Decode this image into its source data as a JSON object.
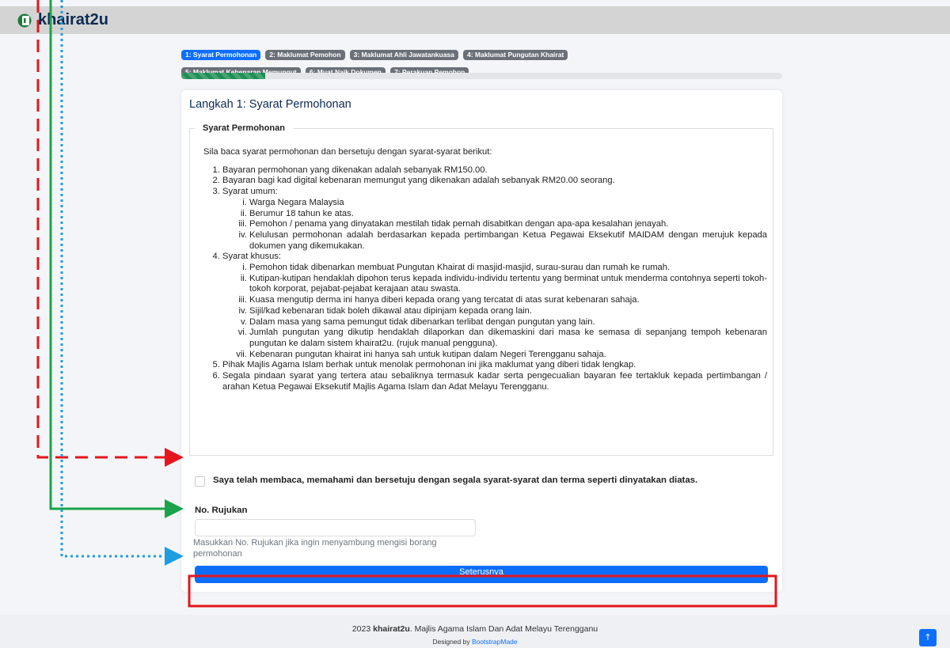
{
  "brand": {
    "name": "khairat2u",
    "logo_icon": "flag-logo-icon"
  },
  "steps": [
    {
      "label": "1: Syarat Permohonan",
      "active": true
    },
    {
      "label": "2: Maklumat Pemohon",
      "active": false
    },
    {
      "label": "3: Maklumat Ahli Jawatankuasa",
      "active": false
    },
    {
      "label": "4: Maklumat Pungutan Khairat",
      "active": false
    },
    {
      "label": "5: Maklumat Kebenaran Memungut",
      "active": false
    },
    {
      "label": "6: Muat Naik Dokumen",
      "active": false
    },
    {
      "label": "7: Perakuan Pemohon",
      "active": false
    }
  ],
  "progress": {
    "fraction": 0.14
  },
  "card": {
    "title": "Langkah 1: Syarat Permohonan",
    "fieldset_legend": "Syarat Permohonan",
    "intro": "Sila baca syarat permohonan dan bersetuju dengan syarat-syarat berikut:",
    "terms": {
      "t1": "Bayaran permohonan yang dikenakan adalah sebanyak RM150.00.",
      "t2": "Bayaran bagi kad digital kebenaran memungut yang dikenakan adalah sebanyak RM20.00 seorang.",
      "t3": "Syarat umum:",
      "t3_sub": [
        "Warga Negara Malaysia",
        "Berumur 18 tahun ke atas.",
        "Pemohon / penama yang dinyatakan mestilah tidak pernah disabitkan dengan apa-apa kesalahan jenayah.",
        "Kelulusan permohonan adalah berdasarkan kepada pertimbangan Ketua Pegawai Eksekutif MAIDAM dengan merujuk kepada dokumen yang dikemukakan."
      ],
      "t4": "Syarat khusus:",
      "t4_sub": [
        "Pemohon tidak dibenarkan membuat Pungutan Khairat di masjid-masjid, surau-surau dan rumah ke rumah.",
        "Kutipan-kutipan hendaklah dipohon terus kepada individu-individu tertentu yang berminat untuk menderma contohnya seperti tokoh-tokoh korporat, pejabat-pejabat kerajaan atau swasta.",
        "Kuasa mengutip derma ini hanya diberi kepada orang yang tercatat di atas surat kebenaran sahaja.",
        "Sijil/kad kebenaran tidak boleh dikawal atau dipinjam kepada orang lain.",
        "Dalam masa yang sama pemungut tidak dibenarkan terlibat dengan pungutan yang lain.",
        "Jumlah pungutan yang dikutip hendaklah dilaporkan dan dikemaskini dari masa ke semasa di sepanjang tempoh kebenaran pungutan ke dalam sistem khairat2u. (rujuk manual pengguna).",
        "Kebenaran pungutan khairat ini hanya sah untuk kutipan dalam Negeri Terengganu sahaja."
      ],
      "t5": "Pihak Majlis Agama Islam berhak untuk menolak permohonan ini jika maklumat yang diberi tidak lengkap.",
      "t6": "Segala pindaan syarat yang tertera atau sebaliknya termasuk kadar serta pengecualian bayaran fee tertakluk kepada pertimbangan / arahan Ketua Pegawai Eksekutif Majlis Agama Islam dan Adat Melayu Terengganu."
    },
    "agree_label": "Saya telah membaca, memahami dan bersetuju dengan segala syarat-syarat dan terma seperti dinyatakan diatas.",
    "agree_checked": false,
    "ref_label": "No. Rujukan",
    "ref_value": "",
    "ref_help": "Masukkan No. Rujukan jika ingin menyambung mengisi borang permohonan",
    "next_label": "Seterusnya"
  },
  "footer": {
    "year": "2023",
    "brand": "khairat2u",
    "org": ". Majlis Agama Islam Dan Adat Melayu Terengganu",
    "designed_by": "Designed by",
    "designer": "BootstrapMade"
  },
  "back_to_top": {
    "icon": "arrow-up-icon",
    "glyph": "↑"
  },
  "annotation_colors": {
    "red": "#e4161c",
    "green": "#1aa34a",
    "blue": "#1e9de0"
  }
}
